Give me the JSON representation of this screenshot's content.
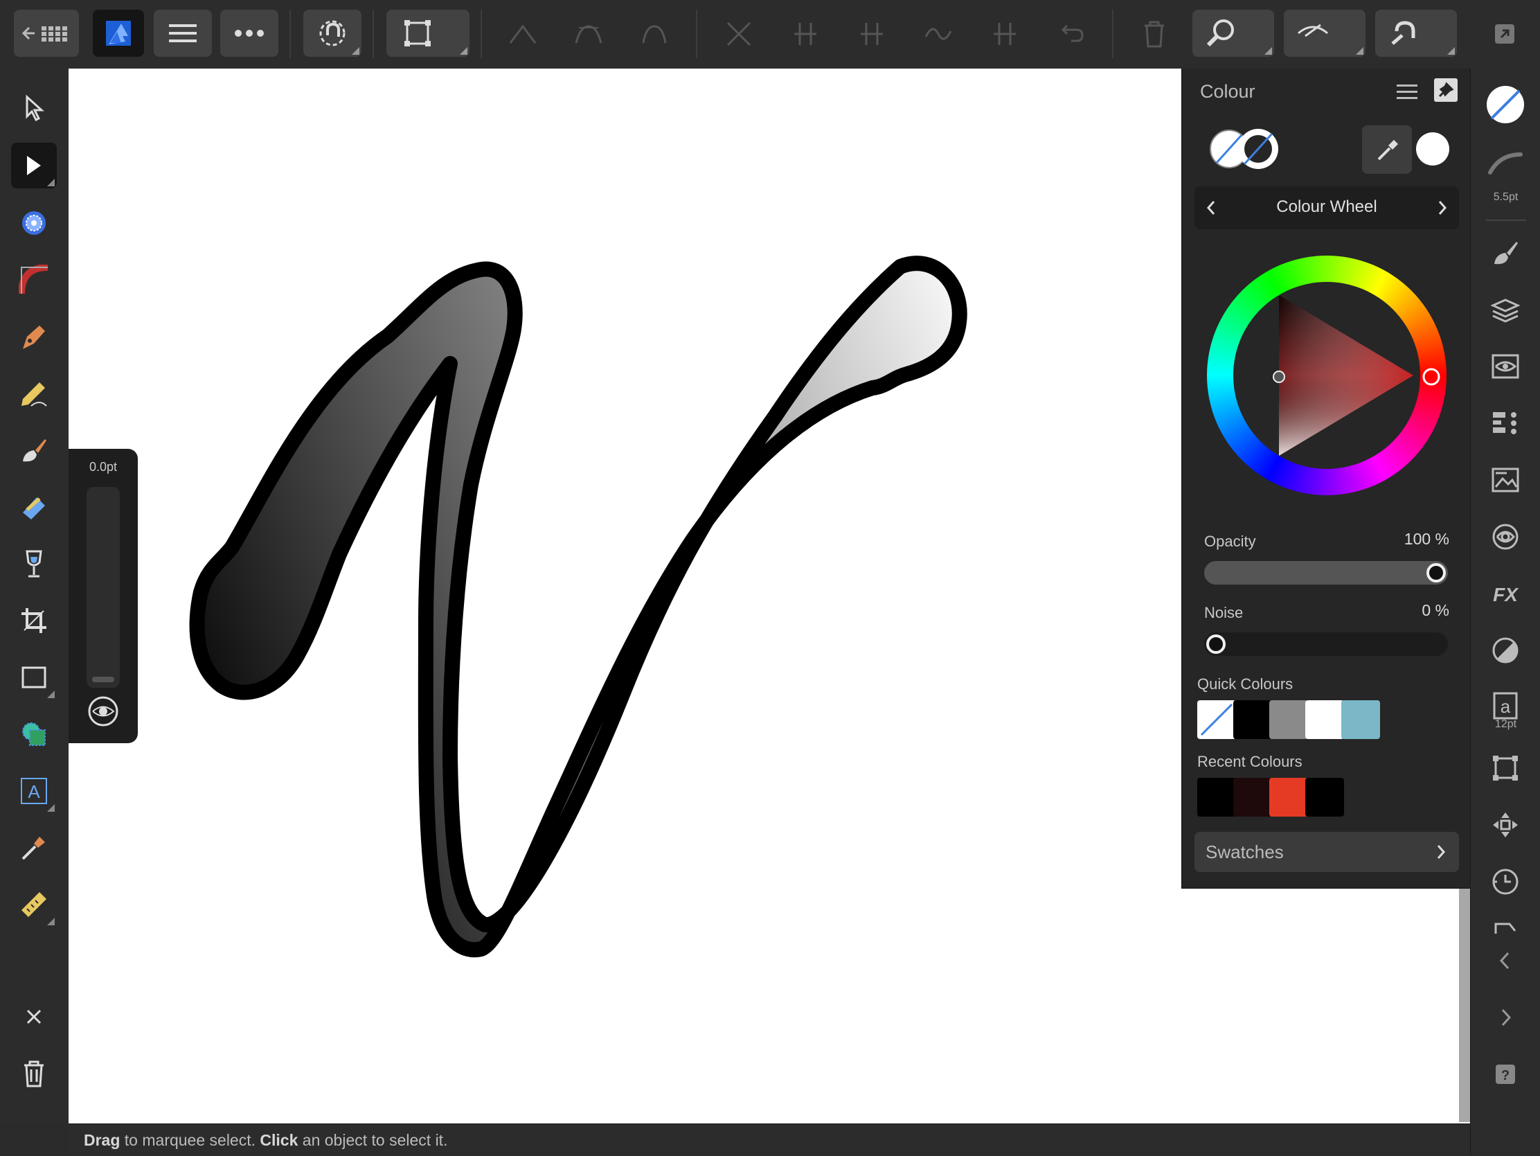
{
  "app": {
    "name": "Affinity Designer",
    "accent": "#3d7fe0"
  },
  "toolbar": {
    "groups": [
      "document",
      "persona",
      "options",
      "snapping",
      "transform",
      "node-tools",
      "delete"
    ]
  },
  "left_tools": [
    "move-tool",
    "node-tool",
    "point-transform-tool",
    "corner-tool",
    "pen-tool",
    "pencil-tool",
    "vector-brush-tool",
    "fill-tool",
    "transparency-tool",
    "crop-tool",
    "rectangle-tool",
    "shape-builder-tool",
    "artistic-text-tool",
    "colour-picker-tool",
    "measure-tool"
  ],
  "stroke_popover": {
    "value": "0.0pt",
    "level": 0
  },
  "status_bar": {
    "drag_word": "Drag",
    "drag_text": " to marquee select. ",
    "click_word": "Click",
    "click_text": " an object to select it."
  },
  "colour_panel": {
    "title": "Colour",
    "mode": "Colour Wheel",
    "opacity_label": "Opacity",
    "opacity_value": "100 %",
    "opacity_level": 1.0,
    "noise_label": "Noise",
    "noise_value": "0 %",
    "noise_level": 0.0,
    "quick_colours_label": "Quick Colours",
    "quick_colours": [
      "none",
      "#000000",
      "#8a8a8a",
      "#ffffff",
      "#7ab8c8"
    ],
    "recent_colours_label": "Recent Colours",
    "recent_colours": [
      "#000000",
      "#1e0a0a",
      "#e53b25",
      "#000000"
    ],
    "swatches_label": "Swatches",
    "hue": "#ff0000"
  },
  "studio": {
    "stroke_width_label": "5.5pt",
    "text_size_label": "12pt"
  }
}
